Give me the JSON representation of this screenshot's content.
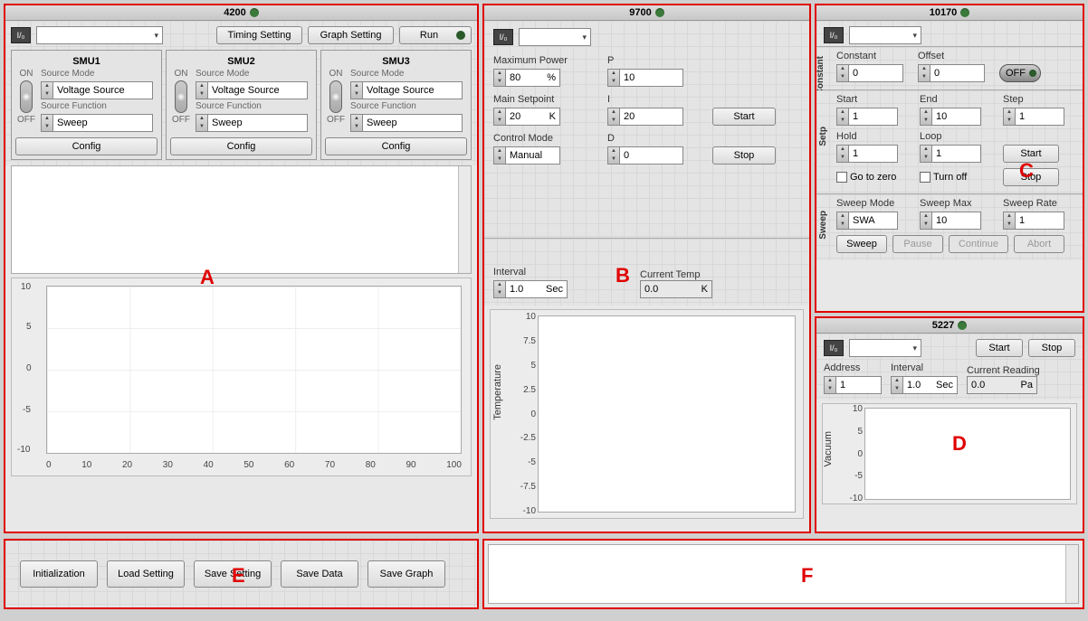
{
  "panelA": {
    "title": "4200",
    "timing_btn": "Timing Setting",
    "graph_btn": "Graph Setting",
    "run_btn": "Run",
    "smu": [
      {
        "name": "SMU1",
        "mode_label": "Source Mode",
        "mode_val": "Voltage Source",
        "func_label": "Source Function",
        "func_val": "Sweep",
        "config": "Config",
        "on": "ON",
        "off": "OFF"
      },
      {
        "name": "SMU2",
        "mode_label": "Source Mode",
        "mode_val": "Voltage Source",
        "func_label": "Source Function",
        "func_val": "Sweep",
        "config": "Config",
        "on": "ON",
        "off": "OFF"
      },
      {
        "name": "SMU3",
        "mode_label": "Source Mode",
        "mode_val": "Voltage Source",
        "func_label": "Source Function",
        "func_val": "Sweep",
        "config": "Config",
        "on": "ON",
        "off": "OFF"
      }
    ],
    "chart_y": [
      "10",
      "5",
      "0",
      "-5",
      "-10"
    ],
    "chart_x": [
      "0",
      "10",
      "20",
      "30",
      "40",
      "50",
      "60",
      "70",
      "80",
      "90",
      "100"
    ]
  },
  "panelB": {
    "title": "9700",
    "max_power_label": "Maximum Power",
    "max_power_val": "80",
    "max_power_unit": "%",
    "main_sp_label": "Main Setpoint",
    "main_sp_val": "20",
    "main_sp_unit": "K",
    "ctrl_mode_label": "Control Mode",
    "ctrl_mode_val": "Manual",
    "p_label": "P",
    "p_val": "10",
    "i_label": "I",
    "i_val": "20",
    "d_label": "D",
    "d_val": "0",
    "start": "Start",
    "stop": "Stop",
    "interval_label": "Interval",
    "interval_val": "1.0",
    "interval_unit": "Sec",
    "curr_temp_label": "Current Temp",
    "curr_temp_val": "0.0",
    "curr_temp_unit": "K",
    "temp_axis_label": "Temperature",
    "chart_y": [
      "10",
      "7.5",
      "5",
      "2.5",
      "0",
      "-2.5",
      "-5",
      "-7.5",
      "-10"
    ]
  },
  "panelC": {
    "title": "10170",
    "constant_tab": "Constant",
    "const_label": "Constant",
    "const_val": "0",
    "offset_label": "Offset",
    "offset_val": "0",
    "off_btn": "OFF",
    "setp_tab": "Setp",
    "start_label": "Start",
    "start_val": "1",
    "end_label": "End",
    "end_val": "10",
    "step_label": "Step",
    "step_val": "1",
    "hold_label": "Hold",
    "hold_val": "1",
    "loop_label": "Loop",
    "loop_val": "1",
    "start_btn": "Start",
    "stop_btn": "Stop",
    "goto_zero": "Go to zero",
    "turn_off": "Turn off",
    "sweep_tab": "Sweep",
    "sweep_mode_label": "Sweep Mode",
    "sweep_mode_val": "SWA",
    "sweep_max_label": "Sweep Max",
    "sweep_max_val": "10",
    "sweep_rate_label": "Sweep Rate",
    "sweep_rate_val": "1",
    "sweep_btn": "Sweep",
    "pause_btn": "Pause",
    "continue_btn": "Continue",
    "abort_btn": "Abort"
  },
  "panelD": {
    "title": "5227",
    "start": "Start",
    "stop": "Stop",
    "addr_label": "Address",
    "addr_val": "1",
    "interval_label": "Interval",
    "interval_val": "1.0",
    "interval_unit": "Sec",
    "reading_label": "Current Reading",
    "reading_val": "0.0",
    "reading_unit": "Pa",
    "vac_label": "Vacuum",
    "chart_y": [
      "10",
      "5",
      "0",
      "-5",
      "-10"
    ]
  },
  "panelE": {
    "init": "Initialization",
    "load": "Load Setting",
    "save_setting": "Save Setting",
    "save_data": "Save Data",
    "save_graph": "Save Graph"
  },
  "letters": {
    "A": "A",
    "B": "B",
    "C": "C",
    "D": "D",
    "E": "E",
    "F": "F"
  },
  "chart_data": [
    {
      "type": "line",
      "title": "",
      "series": [
        {
          "name": "",
          "values": []
        }
      ],
      "x": [],
      "xlim": [
        0,
        100
      ],
      "ylim": [
        -10,
        10
      ],
      "xlabel": "",
      "ylabel": ""
    },
    {
      "type": "line",
      "title": "",
      "series": [
        {
          "name": "Temperature",
          "values": []
        }
      ],
      "x": [],
      "ylim": [
        -10,
        10
      ],
      "xlabel": "",
      "ylabel": "Temperature"
    },
    {
      "type": "line",
      "title": "",
      "series": [
        {
          "name": "Vacuum",
          "values": []
        }
      ],
      "x": [],
      "ylim": [
        -10,
        10
      ],
      "xlabel": "",
      "ylabel": "Vacuum"
    }
  ]
}
